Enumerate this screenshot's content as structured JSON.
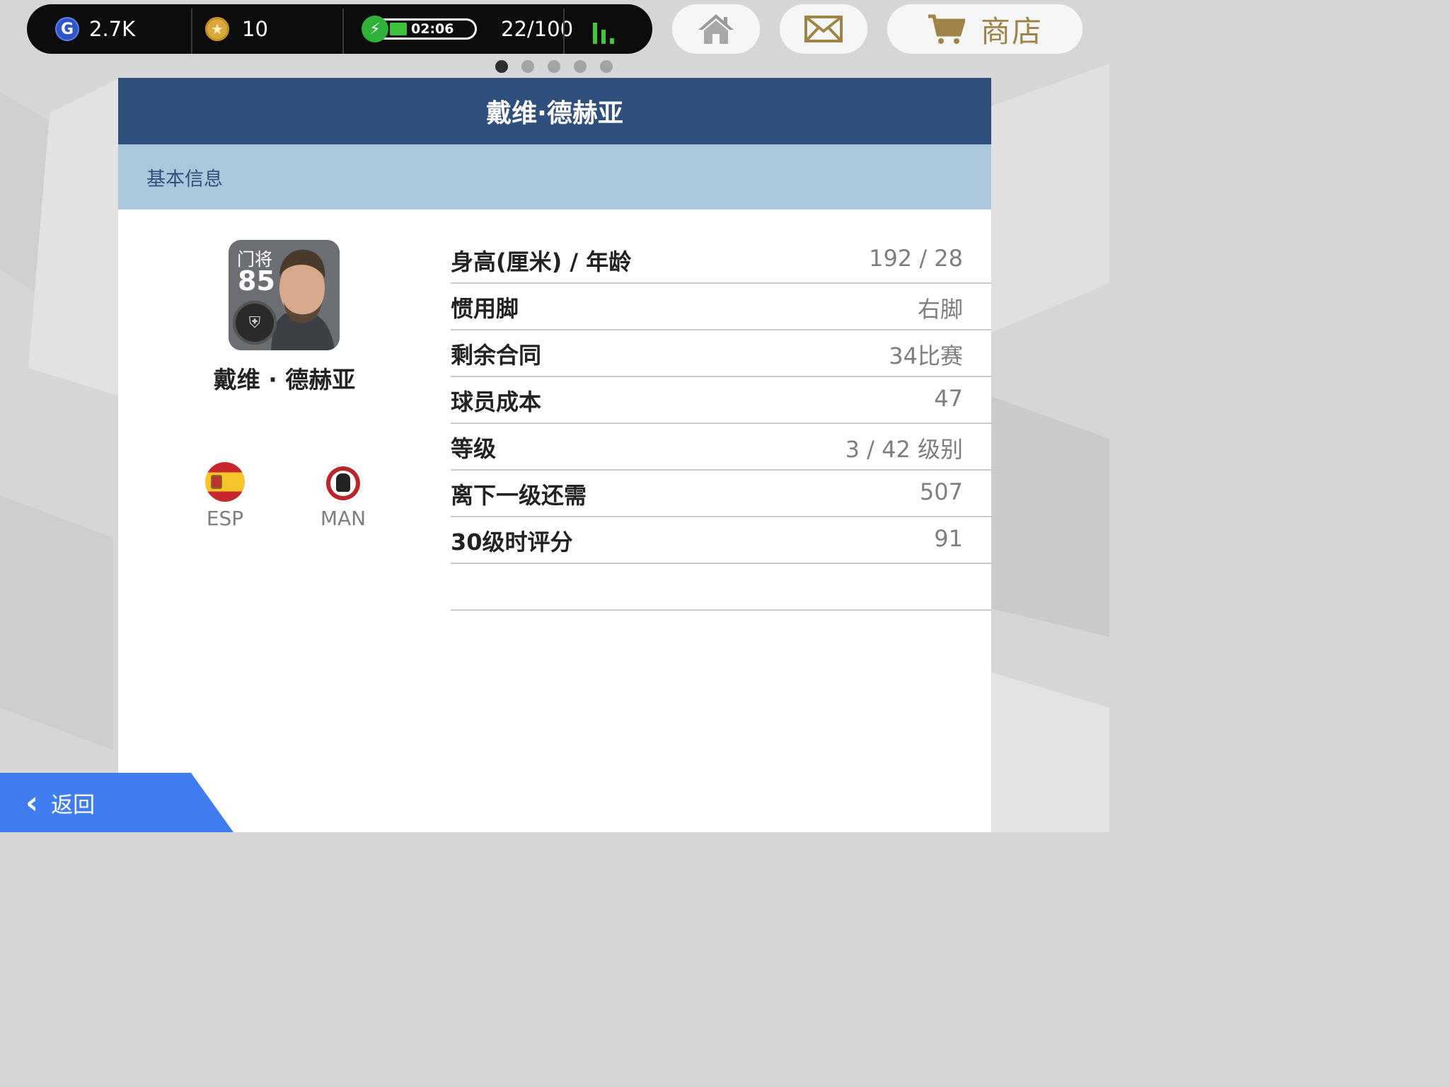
{
  "topbar": {
    "gp_value": "2.7K",
    "coin_value": "10",
    "energy_time": "02:06",
    "energy_count": "22/100"
  },
  "buttons": {
    "shop_label": "商店"
  },
  "pager": {
    "count": 5,
    "active_index": 0
  },
  "panel": {
    "title": "戴维·德赫亚",
    "section_label": "基本信息"
  },
  "player": {
    "position": "门将",
    "rating": "85",
    "name": "戴维 · 德赫亚",
    "nationality": "ESP",
    "club": "MAN"
  },
  "stats": [
    {
      "label": "身高(厘米) / 年龄",
      "value": "192 / 28"
    },
    {
      "label": "惯用脚",
      "value": "右脚"
    },
    {
      "label": "剩余合同",
      "value": "34比赛"
    },
    {
      "label": "球员成本",
      "value": "47"
    },
    {
      "label": "等级",
      "value": "3 / 42 级别"
    },
    {
      "label": "离下一级还需",
      "value": "507"
    },
    {
      "label": "30级时评分",
      "value": "91"
    }
  ],
  "back": {
    "label": "返回"
  },
  "colors": {
    "header": "#2f4f7c",
    "section": "#abc7db",
    "back": "#3f7df0",
    "shop_accent": "#a08447",
    "energy": "#3cc23a"
  }
}
